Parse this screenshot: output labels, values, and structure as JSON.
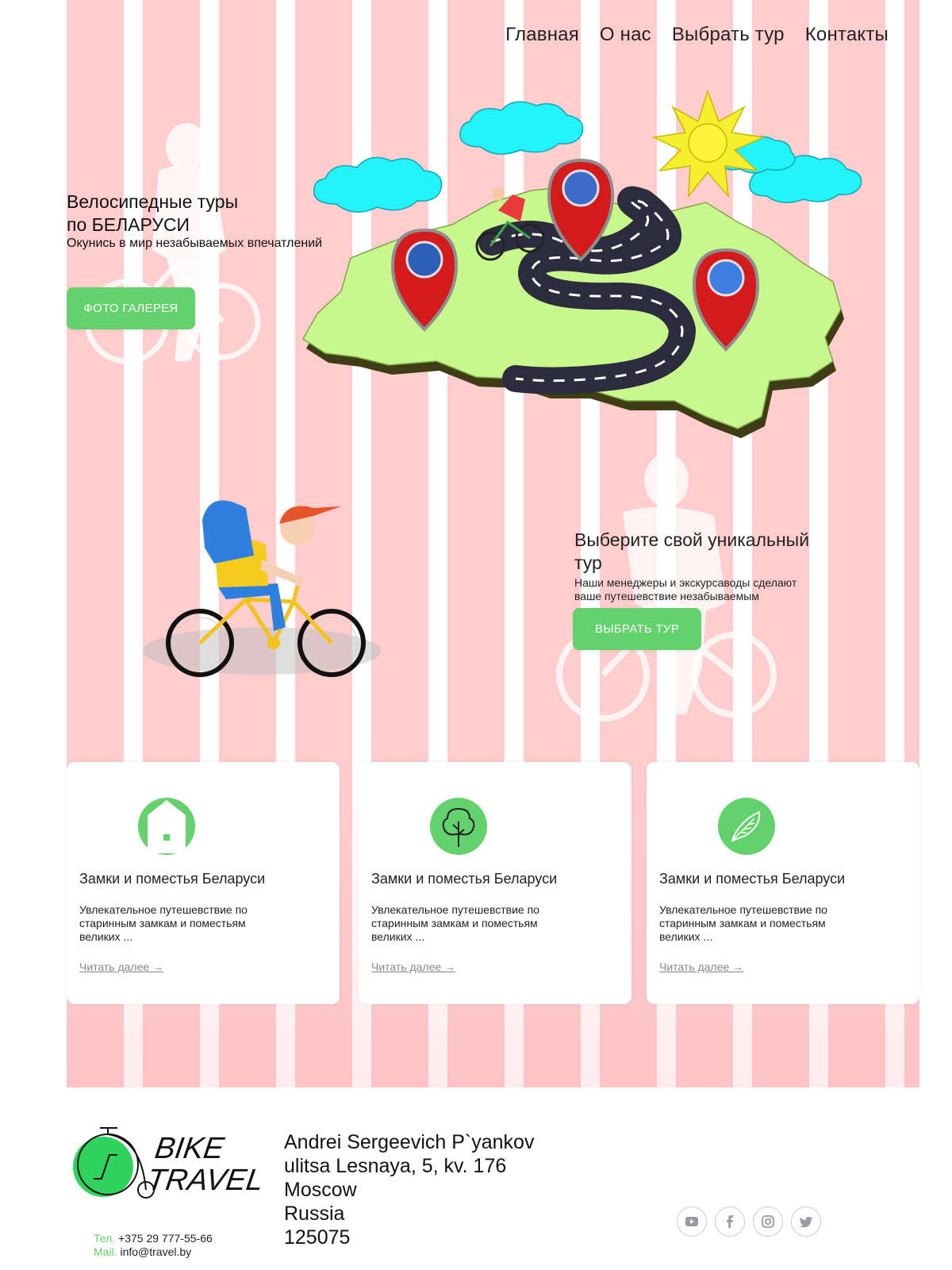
{
  "nav": {
    "items": [
      "Главная",
      "О нас",
      "Выбрать тур",
      "Контакты"
    ]
  },
  "hero": {
    "title_line1": "Велосипедные туры",
    "title_line2": "по БЕЛАРУСИ",
    "subtitle": "Окунись в мир незабываемых впечатлений",
    "button_label": "ФОТО ГАЛЕРЕЯ"
  },
  "tour": {
    "title_line1": "Выберите свой уникальный",
    "title_line2": "тур",
    "text_line1": "Наши менеджеры и экскурсаводы сделают",
    "text_line2": "ваше путешевствие незабываемым",
    "button_label": "ВЫБРАТЬ ТУР"
  },
  "cards": [
    {
      "icon": "house-icon",
      "title": "Замки и поместья Беларуси",
      "text_line1": "Увлекательное путешевствие по",
      "text_line2": "старинным замкам и поместьям",
      "text_line3": "великих ...",
      "link_label": "Читать далее →"
    },
    {
      "icon": "tree-icon",
      "title": "Замки и поместья Беларуси",
      "text_line1": "Увлекательное путешевствие по",
      "text_line2": "старинным замкам и поместьям",
      "text_line3": "великих ...",
      "link_label": "Читать далее →"
    },
    {
      "icon": "feather-icon",
      "title": "Замки и поместья Беларуси",
      "text_line1": "Увлекательное путешевствие по",
      "text_line2": "старинным замкам и поместьям",
      "text_line3": "великих ...",
      "link_label": "Читать далее →"
    }
  ],
  "footer": {
    "logo_line1": "BIKE",
    "logo_line2": "TRAVEL",
    "phone_label": "Тел.",
    "phone": "+375 29 777-55-66",
    "mail_label": "Mail.",
    "mail": "info@travel.by",
    "address": [
      "Andrei Sergeevich P`yankov",
      "ulitsa Lesnaya, 5, kv. 176",
      "Moscow",
      "Russia",
      "125075"
    ],
    "socials": [
      "youtube-icon",
      "facebook-icon",
      "instagram-icon",
      "twitter-icon"
    ]
  },
  "colors": {
    "accent_green": "#63d16c",
    "stripe_pink": "#ffcdcd",
    "map_green": "#c8f78c",
    "cloud_cyan": "#22f4f9",
    "pin_red": "#d41b1b"
  }
}
